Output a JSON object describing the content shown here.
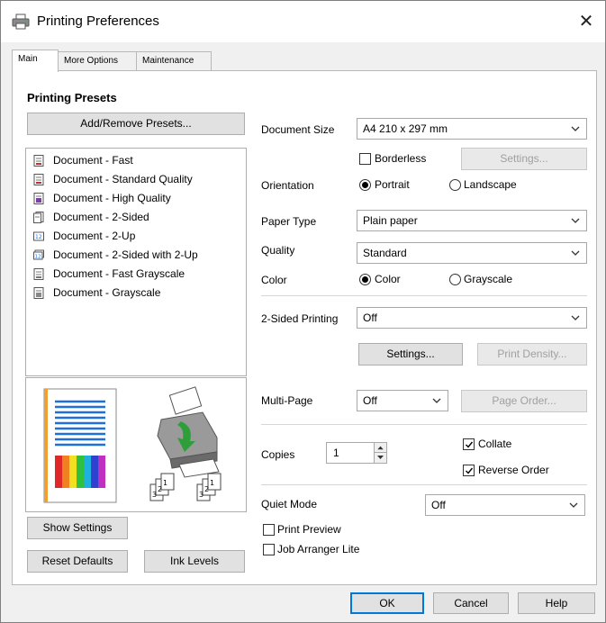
{
  "window": {
    "title": "Printing Preferences",
    "close_glyph": "✕"
  },
  "tabs": [
    {
      "label": "Main",
      "active": true
    },
    {
      "label": "More Options",
      "active": false
    },
    {
      "label": "Maintenance",
      "active": false
    }
  ],
  "presets": {
    "title": "Printing Presets",
    "add_remove_label": "Add/Remove Presets...",
    "items": [
      {
        "label": "Document - Fast",
        "icon": "document-fast-icon"
      },
      {
        "label": "Document - Standard Quality",
        "icon": "document-standard-icon"
      },
      {
        "label": "Document - High Quality",
        "icon": "document-high-quality-icon"
      },
      {
        "label": "Document - 2-Sided",
        "icon": "document-2-sided-icon"
      },
      {
        "label": "Document - 2-Up",
        "icon": "document-2-up-icon"
      },
      {
        "label": "Document - 2-Sided with 2-Up",
        "icon": "document-2-sided-2-up-icon"
      },
      {
        "label": "Document - Fast Grayscale",
        "icon": "document-fast-grayscale-icon"
      },
      {
        "label": "Document - Grayscale",
        "icon": "document-grayscale-icon"
      }
    ]
  },
  "left_buttons": {
    "show_settings": "Show Settings",
    "reset_defaults": "Reset Defaults",
    "ink_levels": "Ink Levels"
  },
  "settings": {
    "document_size": {
      "label": "Document Size",
      "value": "A4 210 x 297 mm"
    },
    "borderless": {
      "label": "Borderless",
      "checked": false
    },
    "borderless_settings_label": "Settings...",
    "orientation": {
      "label": "Orientation",
      "options": [
        "Portrait",
        "Landscape"
      ],
      "selected": "Portrait"
    },
    "paper_type": {
      "label": "Paper Type",
      "value": "Plain paper"
    },
    "quality": {
      "label": "Quality",
      "value": "Standard"
    },
    "color": {
      "label": "Color",
      "options": [
        "Color",
        "Grayscale"
      ],
      "selected": "Color"
    },
    "two_sided": {
      "label": "2-Sided Printing",
      "value": "Off"
    },
    "two_sided_settings_label": "Settings...",
    "print_density_label": "Print Density...",
    "multi_page": {
      "label": "Multi-Page",
      "value": "Off"
    },
    "page_order_label": "Page Order...",
    "copies": {
      "label": "Copies",
      "value": "1"
    },
    "collate": {
      "label": "Collate",
      "checked": true
    },
    "reverse_order": {
      "label": "Reverse Order",
      "checked": true
    },
    "quiet_mode": {
      "label": "Quiet Mode",
      "value": "Off"
    },
    "print_preview": {
      "label": "Print Preview",
      "checked": false
    },
    "job_arranger": {
      "label": "Job Arranger Lite",
      "checked": false
    }
  },
  "dialog_buttons": {
    "ok": "OK",
    "cancel": "Cancel",
    "help": "Help"
  },
  "colors": {
    "accent": "#0078d7",
    "arrow_green": "#2e9e3a",
    "page_lines": "#1e6fd9"
  }
}
